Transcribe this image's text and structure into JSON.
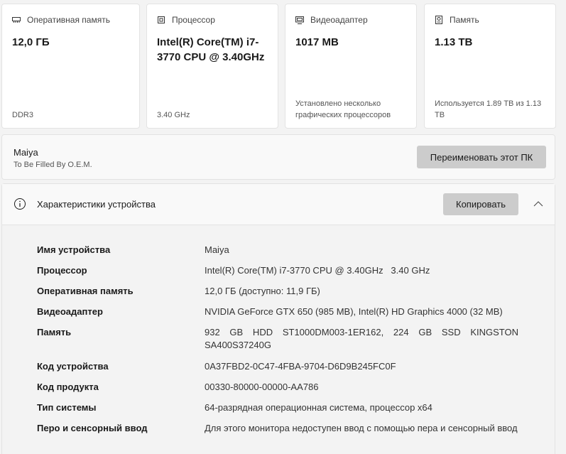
{
  "cards": [
    {
      "icon": "ram-icon",
      "title": "Оперативная память",
      "value": "12,0 ГБ",
      "sub": "DDR3"
    },
    {
      "icon": "processor-icon",
      "title": "Процессор",
      "value": "Intel(R) Core(TM) i7-3770 CPU @ 3.40GHz",
      "sub": "3.40 GHz"
    },
    {
      "icon": "gpu-icon",
      "title": "Видеоадаптер",
      "value": "1017 MB",
      "sub": "Установлено несколько графических процессоров"
    },
    {
      "icon": "storage-icon",
      "title": "Память",
      "value": "1.13 TB",
      "sub": "Используется 1.89 TB из 1.13 TB"
    }
  ],
  "device": {
    "name": "Maiya",
    "description": "To Be Filled By O.E.M.",
    "rename_label": "Переименовать этот ПК"
  },
  "specs": {
    "title": "Характеристики устройства",
    "copy_label": "Копировать",
    "rows": [
      {
        "key": "Имя устройства",
        "value": "Maiya"
      },
      {
        "key": "Процессор",
        "value": "Intel(R) Core(TM) i7-3770 CPU @ 3.40GHz   3.40 GHz"
      },
      {
        "key": "Оперативная память",
        "value": "12,0 ГБ (доступно: 11,9 ГБ)"
      },
      {
        "key": "Видеоадаптер",
        "value": "NVIDIA GeForce GTX 650 (985 MB), Intel(R) HD Graphics 4000 (32 MB)"
      },
      {
        "key": "Память",
        "value": "932 GB HDD ST1000DM003-1ER162, 224 GB SSD KINGSTON SA400S37240G"
      },
      {
        "key": "Код устройства",
        "value": "0A37FBD2-0C47-4FBA-9704-D6D9B245FC0F"
      },
      {
        "key": "Код продукта",
        "value": "00330-80000-00000-AA786"
      },
      {
        "key": "Тип системы",
        "value": "64-разрядная операционная система, процессор x64"
      },
      {
        "key": "Перо и сенсорный ввод",
        "value": "Для этого монитора недоступен ввод с помощью пера и сенсорный ввод"
      }
    ]
  }
}
